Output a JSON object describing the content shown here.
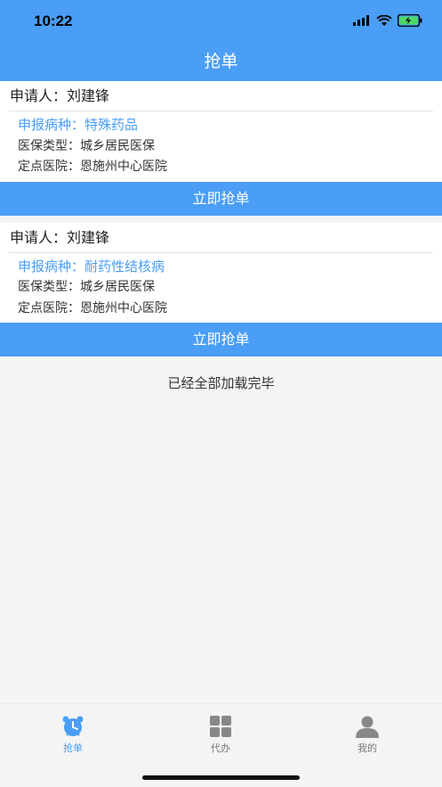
{
  "status": {
    "time": "10:22"
  },
  "nav": {
    "title": "抢单"
  },
  "orders": [
    {
      "applicant": "申请人：刘建锋",
      "disease": "申报病种：特殊药品",
      "insurance": "医保类型：城乡居民医保",
      "hospital": "定点医院：恩施州中心医院",
      "button": "立即抢单"
    },
    {
      "applicant": "申请人：刘建锋",
      "disease": "申报病种：耐药性结核病",
      "insurance": "医保类型：城乡居民医保",
      "hospital": "定点医院：恩施州中心医院",
      "button": "立即抢单"
    }
  ],
  "list_footer": "已经全部加载完毕",
  "tabs": [
    {
      "label": "抢单",
      "icon": "alarm-clock-icon",
      "active": true
    },
    {
      "label": "代办",
      "icon": "grid-icon",
      "active": false
    },
    {
      "label": "我的",
      "icon": "user-icon",
      "active": false
    }
  ],
  "colors": {
    "accent": "#4a9ef5",
    "background": "#f4f4f4"
  }
}
